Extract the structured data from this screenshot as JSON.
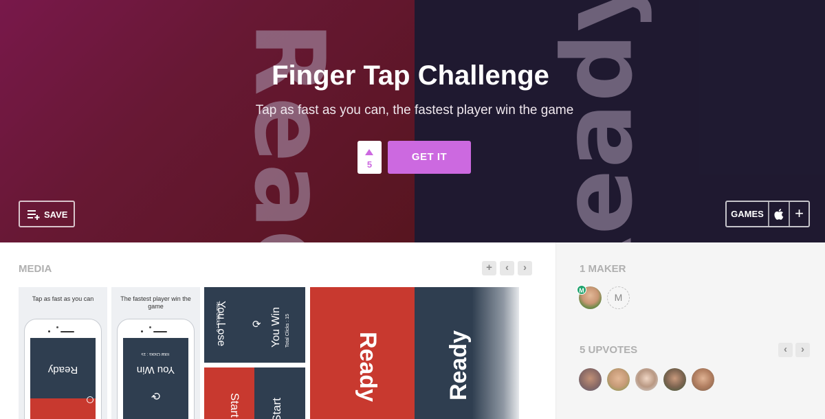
{
  "hero": {
    "bg_word": "Ready",
    "title": "Finger Tap Challenge",
    "tagline": "Tap as fast as you can, the fastest player win the game",
    "upvote_count": "5",
    "get_it_label": "GET IT",
    "save_label": "SAVE",
    "games_label": "GAMES",
    "accent_color": "#cc69e0"
  },
  "media": {
    "title": "MEDIA",
    "add_icon": "plus-icon",
    "prev_icon": "chevron-left-icon",
    "next_icon": "chevron-right-icon",
    "thumbs": [
      {
        "caption": "Tap as fast as you can",
        "screen_text": "Ready"
      },
      {
        "caption": "The fastest player win the game",
        "screen_text": "You Win",
        "screen_sub": "Total Clicks : 15"
      },
      {
        "left_title": "You Lose",
        "left_sub": "Total Clicks : 0",
        "right_title": "You Win",
        "right_sub": "Total Clicks : 15"
      },
      {
        "left_text": "Start",
        "right_text": "Start"
      },
      {
        "left_text": "Ready",
        "right_text": "Ready"
      }
    ]
  },
  "sidebar": {
    "makers_title": "1 MAKER",
    "maker_badge": "M",
    "maker_placeholder": "M",
    "upvotes_title": "5 UPVOTES"
  }
}
